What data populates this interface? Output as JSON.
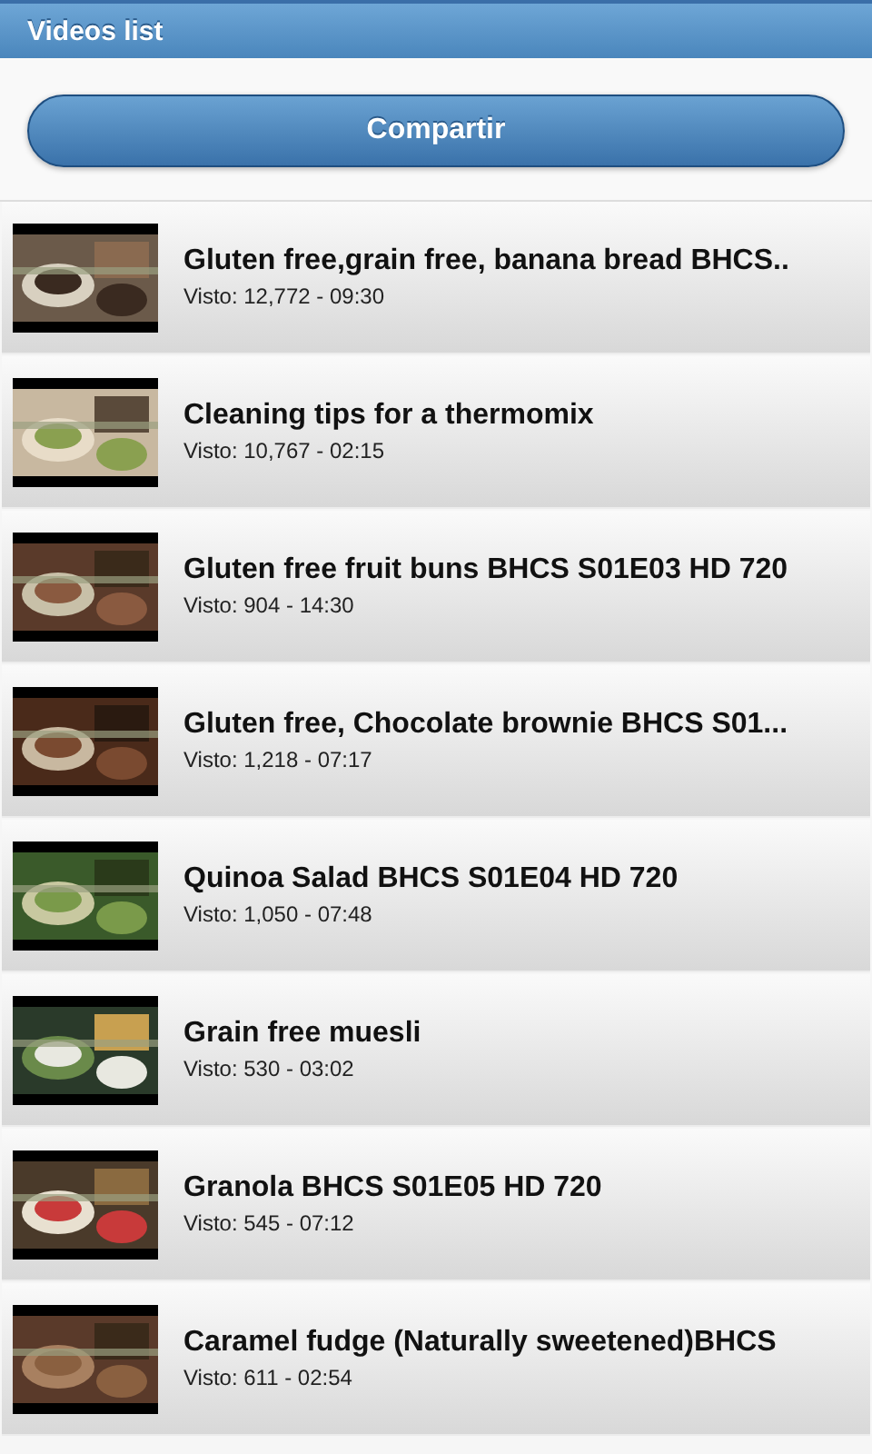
{
  "header": {
    "title": "Videos list"
  },
  "share_button": {
    "label": "Compartir"
  },
  "videos": [
    {
      "title": "Gluten free,grain free, banana bread BHCS..",
      "meta": "Visto: 12,772 - 09:30"
    },
    {
      "title": "Cleaning tips for a thermomix",
      "meta": "Visto: 10,767 - 02:15"
    },
    {
      "title": "Gluten free fruit buns BHCS S01E03 HD 720",
      "meta": "Visto: 904 - 14:30"
    },
    {
      "title": "Gluten free, Chocolate brownie BHCS S01...",
      "meta": "Visto: 1,218 - 07:17"
    },
    {
      "title": "Quinoa Salad BHCS S01E04 HD 720",
      "meta": "Visto: 1,050 - 07:48"
    },
    {
      "title": "Grain free muesli",
      "meta": "Visto: 530 - 03:02"
    },
    {
      "title": "Granola BHCS S01E05 HD 720",
      "meta": "Visto: 545 - 07:12"
    },
    {
      "title": "Caramel fudge (Naturally sweetened)BHCS",
      "meta": "Visto: 611 - 02:54"
    }
  ]
}
